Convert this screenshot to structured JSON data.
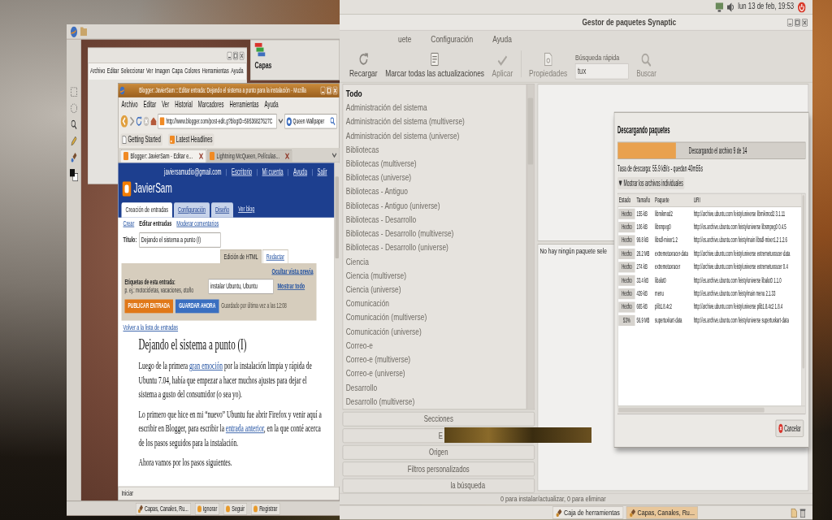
{
  "left_desktop": {
    "image_window": {
      "menu": [
        "Archivo",
        "Editar",
        "Seleccionar",
        "Ver",
        "Imagen",
        "Capa",
        "Colores",
        "Herramientas",
        "Ayuda"
      ]
    },
    "dock": {
      "label": "Capas"
    },
    "browser": {
      "title": "Blogger: JavierSam :: Editar entrada: Dejando el sistema a punto para la instalación - Mozilla",
      "menu": [
        "Archivo",
        "Editar",
        "Ver",
        "Historial",
        "Marcadores",
        "Herramientas",
        "Ayuda"
      ],
      "url": "http://www.blogger.com/post-edit.g?blogID=59536827627C",
      "search": "Queen Wallpaper",
      "bookmarks": [
        "Getting Started",
        "Latest Headlines"
      ],
      "tabs": [
        {
          "label": "Blogger: JavierSam - Editar e...",
          "selected": true
        },
        {
          "label": "Lightning McQueen, Películas...",
          "selected": false
        }
      ],
      "page": {
        "account": "javiersamudio@gmail.com",
        "account_links": [
          "Escritorio",
          "Mi cuenta",
          "Ayuda",
          "Salir"
        ],
        "blog_name": "JavierSam",
        "tabs": [
          {
            "label": "Creación de entradas",
            "selected": true
          },
          {
            "label": "Configuración",
            "selected": false
          },
          {
            "label": "Diseño",
            "selected": false
          }
        ],
        "view_blog": "Ver blog",
        "subtabs": [
          {
            "label": "Crear",
            "selected": false
          },
          {
            "label": "Editar entradas",
            "selected": true
          },
          {
            "label": "Moderar comentarios",
            "selected": false
          }
        ],
        "title_label": "Título:",
        "title_value": "Dejando el sistema a punto (I)",
        "editor_tabs": [
          {
            "label": "Edición de HTML",
            "selected": true
          },
          {
            "label": "Redactar",
            "selected": false
          }
        ],
        "hide_preview": "Ocultar vista previa",
        "labels_label": "Etiquetas de esta entrada:",
        "labels_hint": "p. ej.: motocicletas, vacaciones, otoño",
        "labels_value": "instalar Ubuntu, Ubuntu",
        "show_all": "Mostrar todo",
        "buttons": [
          {
            "label": "PUBLICAR ENTRADA",
            "kind": "publish"
          },
          {
            "label": "GUARDAR AHORA",
            "kind": "save"
          }
        ],
        "saved_note": "Guardado por última vez a las 12:08",
        "back_link": "Volver a la lista de entradas",
        "heading": "Dejando el sistema a punto (I)",
        "paragraphs": [
          [
            {
              "text": "Luego de la primera "
            },
            {
              "text": "gran emoción",
              "kind": "link"
            },
            {
              "text": " por la instalación limpia y rápida de Ubuntu 7.04, había que empezar a hacer muchos ajustes para dejar el sistema a gusto del consumidor (o sea yo)."
            }
          ],
          [
            {
              "text": "Lo primero que hice en mi “nuevo” Ubuntu fue abrir Firefox y venir aquí a escribir en Blogger, para escribir la "
            },
            {
              "text": "entrada anterior",
              "kind": "link"
            },
            {
              "text": ", en la que conté acerca de los pasos seguidos para la instalación."
            }
          ],
          [
            {
              "text": "Ahora vamos por los pasos siguientes."
            }
          ]
        ]
      },
      "status": "Iniciar"
    },
    "taskbar": [
      "Capas, Canales, Ru...",
      "Ignorar",
      "Seguir",
      "Registrar"
    ]
  },
  "right_desktop": {
    "top_panel": {
      "clock": "lun 13 de feb, 19:53"
    },
    "synaptic": {
      "title": "Gestor de paquetes Synaptic",
      "menu": [
        "uete",
        "Configuración",
        "Ayuda"
      ],
      "toolbar": [
        {
          "label": "Recargar",
          "kind": "reload",
          "disabled": false
        },
        {
          "label": "Marcar todas las actualizaciones",
          "kind": "mark",
          "disabled": false
        },
        {
          "label": "Aplicar",
          "kind": "apply",
          "disabled": true
        },
        {
          "label": "Propiedades",
          "kind": "properties",
          "disabled": true
        }
      ],
      "quick_search": {
        "label": "Búsqueda rápida",
        "value": "tux"
      },
      "search_button": "Buscar",
      "sections": [
        {
          "label": "Todo",
          "selected": true
        },
        {
          "label": "Administración del sistema",
          "selected": false
        },
        {
          "label": "Administración del sistema (multiverse)",
          "selected": false
        },
        {
          "label": "Administración del sistema (universe)",
          "selected": false
        },
        {
          "label": "Bibliotecas",
          "selected": false
        },
        {
          "label": "Bibliotecas (multiverse)",
          "selected": false
        },
        {
          "label": "Bibliotecas (universe)",
          "selected": false
        },
        {
          "label": "Bibliotecas - Antiguo",
          "selected": false
        },
        {
          "label": "Bibliotecas - Antiguo (universe)",
          "selected": false
        },
        {
          "label": "Bibliotecas - Desarrollo",
          "selected": false
        },
        {
          "label": "Bibliotecas - Desarrollo (multiverse)",
          "selected": false
        },
        {
          "label": "Bibliotecas - Desarrollo (universe)",
          "selected": false
        },
        {
          "label": "Ciencia",
          "selected": false
        },
        {
          "label": "Ciencia (multiverse)",
          "selected": false
        },
        {
          "label": "Ciencia (universe)",
          "selected": false
        },
        {
          "label": "Comunicación",
          "selected": false
        },
        {
          "label": "Comunicación (multiverse)",
          "selected": false
        },
        {
          "label": "Comunicación (universe)",
          "selected": false
        },
        {
          "label": "Correo-e",
          "selected": false
        },
        {
          "label": "Correo-e (multiverse)",
          "selected": false
        },
        {
          "label": "Correo-e (universe)",
          "selected": false
        },
        {
          "label": "Desarrollo",
          "selected": false
        },
        {
          "label": "Desarrollo (multiverse)",
          "selected": false
        }
      ],
      "filters": [
        "Secciones",
        "E",
        "Origen",
        "Filtros personalizados",
        "la búsqueda"
      ],
      "description": "No hay ningún paquete sele",
      "status": "0 para instalar/actualizar, 0 para eliminar"
    },
    "download": {
      "title": "Descargando paquetes",
      "progress": {
        "level": 0.31,
        "text": "Descargando el archivo 9 de 14"
      },
      "rate": "Tasa de descarga: 55.9 kB/s - quedan 40m55s",
      "details": {
        "label": "Mostrar los archivos individuales",
        "expanded": true
      },
      "columns": [
        "Estado",
        "Tamaño",
        "Paquete",
        "URI"
      ],
      "rows": [
        {
          "status": "Hecho",
          "size": "155 kB",
          "package": "libmikmod2",
          "uri": "http://archive.ubuntu.com feisty/universe libmikmod2 3.1.11"
        },
        {
          "status": "Hecho",
          "size": "106 kB",
          "package": "libsmpeg0",
          "uri": "http://es.archive.ubuntu.com feisty/universe libsmpeg0 0.4.5"
        },
        {
          "status": "Hecho",
          "size": "99.8 kB",
          "package": "libsdl-mixer1.2",
          "uri": "http://es.archive.ubuntu.com feisty/main libsdl-mixer1.2 1.2.6"
        },
        {
          "status": "Hecho",
          "size": "28.2 MB",
          "package": "extremetuxracer-data",
          "uri": "http://archive.ubuntu.com feisty/universe extremetuxracer-data"
        },
        {
          "status": "Hecho",
          "size": "274 kB",
          "package": "extremetuxracer",
          "uri": "http://archive.ubuntu.com feisty/universe extremetuxracer 0.4"
        },
        {
          "status": "Hecho",
          "size": "33.4 kB",
          "package": "libalut0",
          "uri": "http://es.archive.ubuntu.com feisty/universe libalut0 1.1.0"
        },
        {
          "status": "Hecho",
          "size": "439 kB",
          "package": "menu",
          "uri": "http://es.archive.ubuntu.com feisty/main menu 2.1.33"
        },
        {
          "status": "Hecho",
          "size": "665 kB",
          "package": "plib1.8.4c2",
          "uri": "http://archive.ubuntu.com feisty/universe plib1.8.4c2 1.8.4"
        },
        {
          "status": "53%",
          "size": "56.9 MB",
          "package": "supertuxkart-data",
          "uri": "http://es.archive.ubuntu.com feisty/universe supertuxkart-data"
        }
      ],
      "cancel": "Cancelar"
    },
    "taskbar": [
      {
        "label": "Caja de herramientas",
        "selected": false
      },
      {
        "label": "Capas, Canales, Ru...",
        "selected": true
      }
    ]
  }
}
